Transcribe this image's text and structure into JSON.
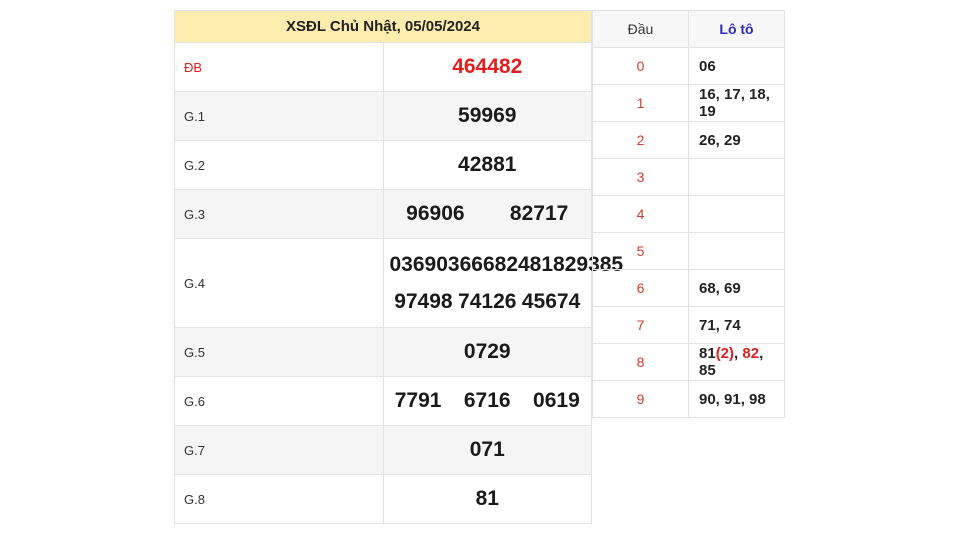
{
  "title": "XSĐL Chủ Nhật, 05/05/2024",
  "prizes": [
    {
      "label": "ĐB",
      "values": [
        "464482"
      ]
    },
    {
      "label": "G.1",
      "values": [
        "59969"
      ]
    },
    {
      "label": "G.2",
      "values": [
        "42881"
      ]
    },
    {
      "label": "G.3",
      "values": [
        "96906",
        "82717"
      ]
    },
    {
      "label": "G.4",
      "values": [
        "03690",
        "36668",
        "24818",
        "29385",
        "97498",
        "74126",
        "45674"
      ]
    },
    {
      "label": "G.5",
      "values": [
        "0729"
      ]
    },
    {
      "label": "G.6",
      "values": [
        "7791",
        "6716",
        "0619"
      ]
    },
    {
      "label": "G.7",
      "values": [
        "071"
      ]
    },
    {
      "label": "G.8",
      "values": [
        "81"
      ]
    }
  ],
  "loto": {
    "header_dau": "Đầu",
    "header_loto": "Lô tô",
    "rows": [
      {
        "head": "0",
        "tails": "06"
      },
      {
        "head": "1",
        "tails": "16, 17, 18, 19"
      },
      {
        "head": "2",
        "tails": "26, 29"
      },
      {
        "head": "3",
        "tails": ""
      },
      {
        "head": "4",
        "tails": ""
      },
      {
        "head": "5",
        "tails": ""
      },
      {
        "head": "6",
        "tails": "68, 69"
      },
      {
        "head": "7",
        "tails": "71, 74"
      },
      {
        "head": "8",
        "tails_parts": {
          "p1": "81",
          "p2": "(2)",
          "p3": ", ",
          "p4": "82",
          "p5": ", 85"
        }
      },
      {
        "head": "9",
        "tails": "90, 91, 98"
      }
    ]
  },
  "colors": {
    "title_bg": "#fcecad",
    "special_red": "#e02020",
    "loto_header_blue": "#2b2bc2",
    "head_red": "#d23c2a"
  }
}
